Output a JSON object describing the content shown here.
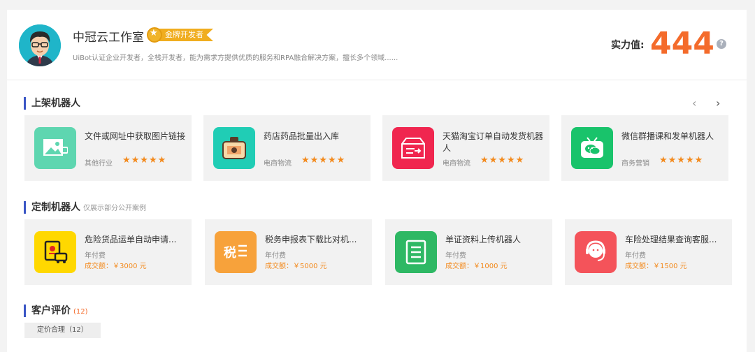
{
  "profile": {
    "name": "中冠云工作室",
    "badge": "金牌开发者",
    "description": "UiBot认证企业开发者，全栈开发者，能为需求方提供优质的服务和RPA融合解决方案，擅长多个领域......",
    "power_label": "实力值:",
    "power_value": "444",
    "help": "?"
  },
  "listed": {
    "title": "上架机器人",
    "prev": "‹",
    "next": "›",
    "items": [
      {
        "name": "文件或网址中获取图片链接",
        "category": "其他行业",
        "stars": "★★★★★",
        "icon": "image-link-icon",
        "color": "#5ed6b0"
      },
      {
        "name": "药店药品批量出入库",
        "category": "电商物流",
        "stars": "★★★★★",
        "icon": "medicine-box-icon",
        "color": "#20cdb5"
      },
      {
        "name": "天猫淘宝订单自动发货机器人",
        "category": "电商物流",
        "stars": "★★★★★",
        "icon": "shipping-box-icon",
        "color": "#f0264f"
      },
      {
        "name": "微信群播课和发单机器人",
        "category": "商务营销",
        "stars": "★★★★★",
        "icon": "wechat-tv-icon",
        "color": "#19c36b"
      }
    ]
  },
  "custom": {
    "title": "定制机器人",
    "note": "仅展示部分公开案例",
    "items": [
      {
        "name": "危险货品运单自动申请...",
        "fee": "年付费",
        "deal": "成交额：￥3000 元",
        "icon": "hazard-truck-icon",
        "color": "#ffd800"
      },
      {
        "name": "税务申报表下载比对机...",
        "fee": "年付费",
        "deal": "成交额：￥5000 元",
        "icon": "tax-form-icon",
        "color": "#f7a23b"
      },
      {
        "name": "单证资料上传机器人",
        "fee": "年付费",
        "deal": "成交额：￥1000 元",
        "icon": "document-icon",
        "color": "#2eb864"
      },
      {
        "name": "车险处理结果查询客服...",
        "fee": "年付费",
        "deal": "成交额：￥1500 元",
        "icon": "customer-service-icon",
        "color": "#f4535a"
      }
    ]
  },
  "reviews": {
    "title": "客户评价",
    "count": "(12)",
    "tag": "定价合理（12）"
  }
}
